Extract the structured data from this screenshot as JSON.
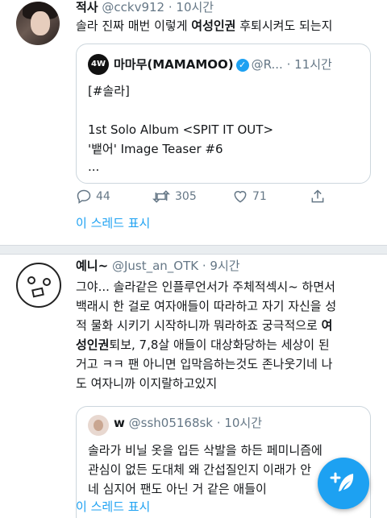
{
  "tweet1": {
    "name": "적사",
    "handle": "@cckv912",
    "time": "· 10시간",
    "text_plain": "솔라 진짜 매번 이렇게 ",
    "text_bold": "여성인권",
    "text_tail": " 후퇴시켜도 되는지",
    "quote": {
      "name": "마마무(MAMAMOO)",
      "logo_text": "4W",
      "handle": "@R...",
      "time": "· 11시간",
      "line1": "[#솔라]",
      "line2": "1st Solo Album <SPIT IT OUT>",
      "line3": "'뱉어' Image Teaser #6",
      "line4": "..."
    },
    "actions": {
      "replies": "44",
      "retweets": "305",
      "likes": "71"
    },
    "show_thread": "이 스레드 표시"
  },
  "tweet2": {
    "name": "예니~",
    "handle": "@Just_an_OTK",
    "time": "· 9시간",
    "lines": [
      "그야... 솔라같은 인플루언서가 주체적섹시~ 하면서",
      "백래시 한 걸로 여자애들이 따라하고 자기 자신을 성",
      "적 물화 시키기 시작하니까 뭐라하죠 궁극적으로 "
    ],
    "bold_a": "여",
    "bold_b": "성인권",
    "line4_tail": "퇴보, 7,8살 애들이 대상화당하는 세상이 된",
    "line5": "거고 ㅋㅋ 팬 아니면 입막음하는것도 존나웃기네 나",
    "line6": "도 여자니까 이지랄하고있지",
    "quote": {
      "name": "w",
      "handle": "@ssh05168sk",
      "time": "· 10시간",
      "line1": "솔라가 비닐 옷을 입든 삭발을 하든 페미니즘에",
      "line2": "관심이 없든 도대체 왜 간섭질인지 이래가 안",
      "line3": "네 심지어 팬도 아닌 거 같은 애들이"
    },
    "show_thread": "이 스레드 표시"
  },
  "colors": {
    "accent": "#1da1f2",
    "muted": "#657786",
    "text": "#14171a",
    "border": "#ccd6dd"
  }
}
